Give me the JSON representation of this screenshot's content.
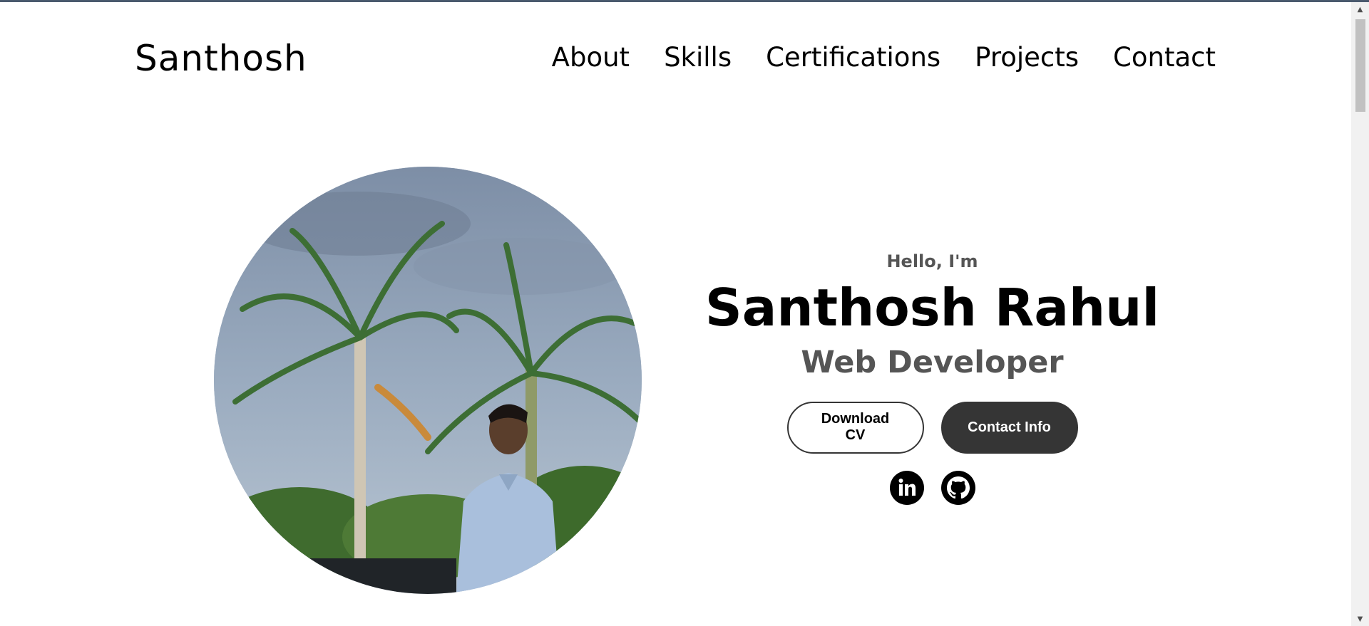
{
  "nav": {
    "logo": "Santhosh",
    "links": [
      "About",
      "Skills",
      "Certifications",
      "Projects",
      "Contact"
    ]
  },
  "hero": {
    "greeting": "Hello, I'm",
    "name": "Santhosh Rahul",
    "role": "Web Developer",
    "download_label": "Download CV",
    "contact_label": "Contact Info"
  },
  "socials": [
    {
      "icon": "linkedin-icon"
    },
    {
      "icon": "github-icon"
    }
  ],
  "colors": {
    "dark_button": "#353535",
    "subtext": "#555555"
  }
}
